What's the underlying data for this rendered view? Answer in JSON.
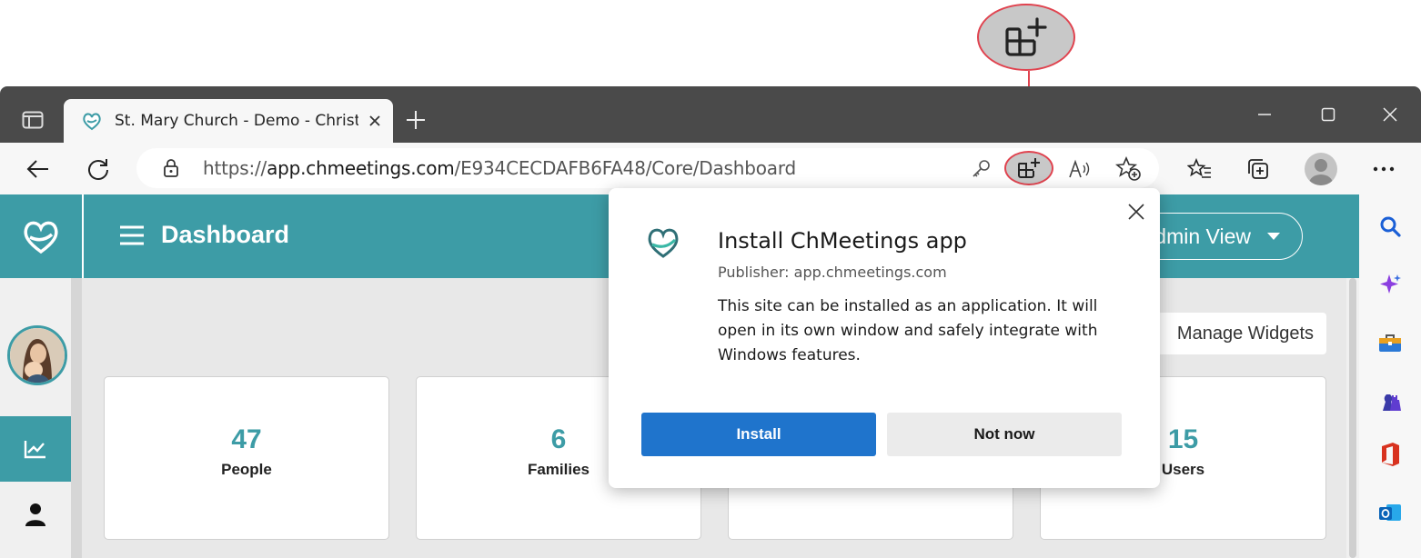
{
  "tab": {
    "title": "St. Mary Church - Demo - Christian"
  },
  "address": {
    "url_prefix": "https://",
    "url_host": "app.chmeetings.com",
    "url_path": "/E934CECDAFB6FA48/Core/Dashboard"
  },
  "app": {
    "page_title": "Dashboard",
    "view_selector": "Admin View",
    "manage_widgets": "Manage Widgets",
    "stats": [
      {
        "value": "47",
        "label": "People"
      },
      {
        "value": "6",
        "label": "Families"
      },
      {
        "value": "",
        "label": ""
      },
      {
        "value": "15",
        "label": "Users"
      }
    ]
  },
  "dialog": {
    "title": "Install ChMeetings app",
    "publisher": "Publisher: app.chmeetings.com",
    "body": "This site can be installed as an application. It will open in its own window and safely integrate with Windows features.",
    "install_label": "Install",
    "notnow_label": "Not now"
  },
  "colors": {
    "brand": "#3d9ca6",
    "install": "#1f74cc",
    "callout": "#e0434f"
  }
}
